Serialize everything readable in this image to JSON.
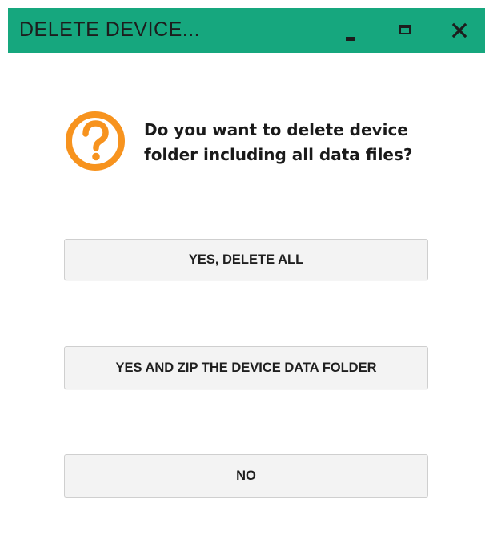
{
  "window": {
    "title": "DELETE DEVICE...",
    "title_bar_color": "#16a77e",
    "controls": {
      "minimize_icon": "minimize-icon",
      "maximize_icon": "maximize-icon",
      "close_icon": "close-icon"
    }
  },
  "dialog": {
    "icon": "question-circle-icon",
    "icon_color": "#f7931e",
    "message": "Do you want to delete device folder including all data files?"
  },
  "buttons": {
    "delete_all": "YES, DELETE ALL",
    "zip_folder": "YES AND ZIP THE DEVICE DATA FOLDER",
    "no": "NO"
  }
}
